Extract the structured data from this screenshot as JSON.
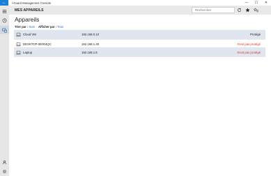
{
  "window": {
    "title": "i-Guard Management Console",
    "back_glyph": "←",
    "minimize": "—",
    "maximize": "☐",
    "close": "✕"
  },
  "header": {
    "title": "MES APPAREILS",
    "search_placeholder": "Rechercher"
  },
  "page": {
    "title": "Appareils",
    "sort_label": "Trier par :",
    "sort_value": "Nom",
    "display_label": "Afficher par :",
    "display_value": "Tous"
  },
  "devices": [
    {
      "name": "Cloud VM",
      "ip": "192.168.0.10",
      "status": "Protégé",
      "status_kind": "ok",
      "selected": true
    },
    {
      "name": "DESKTOP-0E004QC",
      "ip": "192.168.1.30",
      "status": "N'est pas protégé",
      "status_kind": "bad",
      "selected": false
    },
    {
      "name": "Laptop",
      "ip": "192.168.1.8",
      "status": "N'est pas protégé",
      "status_kind": "bad",
      "selected": true
    }
  ],
  "sidebar": {
    "items": [
      {
        "icon": "hamburger-icon"
      },
      {
        "icon": "clock-icon"
      },
      {
        "icon": "devices-icon",
        "active": true
      },
      {
        "icon": "user-icon"
      },
      {
        "icon": "gear-icon"
      }
    ]
  },
  "colors": {
    "accent": "#1a7fd6",
    "selected_row": "#dfe6f0",
    "sidebar": "#e6e6e6",
    "header": "#e9e9e9",
    "danger": "#d9342b",
    "link": "#1a73c9"
  }
}
